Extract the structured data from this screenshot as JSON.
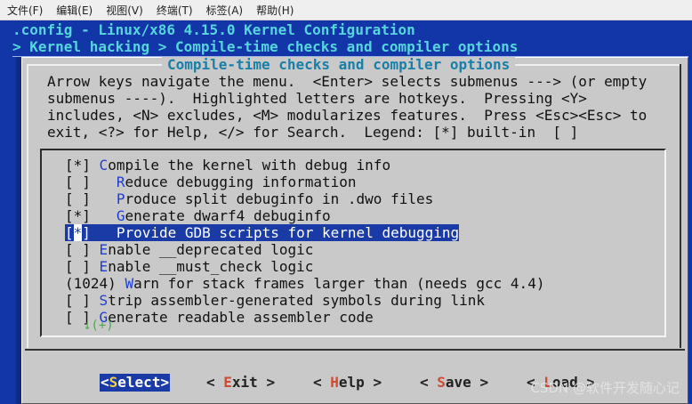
{
  "menubar": {
    "items": [
      "文件(F)",
      "编辑(E)",
      "视图(V)",
      "终端(T)",
      "标签(A)",
      "帮助(H)"
    ]
  },
  "terminal": {
    "title_line": ".config - Linux/x86 4.15.0 Kernel Configuration",
    "breadcrumb_line": "> Kernel hacking > Compile-time checks and compiler options"
  },
  "dialog": {
    "title": "Compile-time checks and compiler options",
    "help_lines": [
      "Arrow keys navigate the menu.  <Enter> selects submenus ---> (or empty",
      "submenus ----).  Highlighted letters are hotkeys.  Pressing <Y>",
      "includes, <N> excludes, <M> modularizes features.  Press <Esc><Esc> to",
      "exit, <?> for Help, </> for Search.  Legend: [*] built-in  [ ]"
    ],
    "items": [
      {
        "mark": "[*]",
        "indent": " ",
        "hotkey": "C",
        "rest": "ompile the kernel with debug info",
        "selected": false
      },
      {
        "mark": "[ ]",
        "indent": "   ",
        "hotkey": "R",
        "rest": "educe debugging information",
        "selected": false
      },
      {
        "mark": "[ ]",
        "indent": "   ",
        "hotkey": "P",
        "rest": "roduce split debuginfo in .dwo files",
        "selected": false
      },
      {
        "mark": "[*]",
        "indent": "   ",
        "hotkey": "G",
        "rest": "enerate dwarf4 debuginfo",
        "selected": false
      },
      {
        "mark": "[*]",
        "indent": "   ",
        "hotkey": "P",
        "rest": "rovide GDB scripts for kernel debugging",
        "selected": true
      },
      {
        "mark": "[ ]",
        "indent": " ",
        "hotkey": "E",
        "rest": "nable __deprecated logic",
        "selected": false
      },
      {
        "mark": "[ ]",
        "indent": " ",
        "hotkey": "E",
        "rest": "nable __must_check logic",
        "selected": false
      },
      {
        "mark": "(1024)",
        "indent": " ",
        "hotkey": "W",
        "rest": "arn for stack frames larger than (needs gcc 4.4)",
        "selected": false
      },
      {
        "mark": "[ ]",
        "indent": " ",
        "hotkey": "S",
        "rest": "trip assembler-generated symbols during link",
        "selected": false
      },
      {
        "mark": "[ ]",
        "indent": " ",
        "hotkey": "G",
        "rest": "enerate readable assembler code",
        "selected": false
      }
    ],
    "more_indicator": "↓(+)",
    "buttons": [
      {
        "open": "<",
        "hotkey": "S",
        "rest": "elect",
        "close": ">",
        "active": true
      },
      {
        "open": "< ",
        "hotkey": "E",
        "rest": "xit",
        "close": " >",
        "active": false
      },
      {
        "open": "< ",
        "hotkey": "H",
        "rest": "elp",
        "close": " >",
        "active": false
      },
      {
        "open": "< ",
        "hotkey": "S",
        "rest": "ave",
        "close": " >",
        "active": false
      },
      {
        "open": "< ",
        "hotkey": "L",
        "rest": "oad",
        "close": " >",
        "active": false
      }
    ]
  },
  "watermark": "CSDN @软件开发随心记",
  "colors": {
    "terminal_bg": "#1236a8",
    "dialog_bg": "#c9c9c9",
    "selection_bg": "#1a3aa6",
    "hotkey": "#1f3ed0",
    "title_cyan": "#56d6dc",
    "button_hotkey": "#d04a32"
  }
}
